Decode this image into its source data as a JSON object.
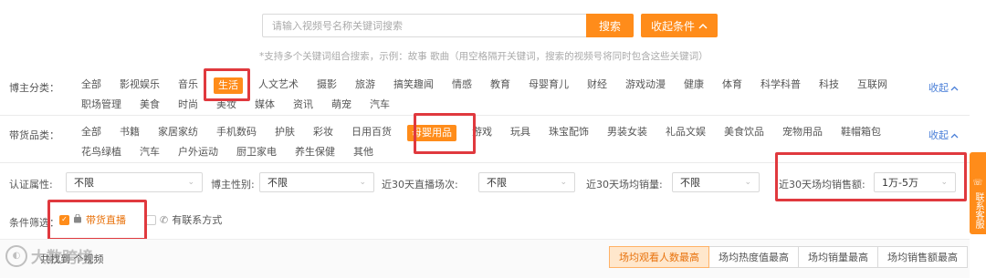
{
  "search": {
    "placeholder": "请输入视频号名称关键词搜索",
    "button_label": "搜索",
    "collapse_label": "收起条件",
    "hint": "*支持多个关键词组合搜索，示例：故事 歌曲（用空格隔开关键词，搜索的视频号将同时包含这些关键词）"
  },
  "blogger_category": {
    "label": "博主分类：",
    "items": [
      "全部",
      "影视娱乐",
      "音乐",
      "生活",
      "人文艺术",
      "摄影",
      "旅游",
      "搞笑趣闻",
      "情感",
      "教育",
      "母婴育儿",
      "财经",
      "游戏动漫",
      "健康",
      "体育",
      "科学科普",
      "科技",
      "互联网",
      "职场管理",
      "美食",
      "时尚",
      "美妆",
      "媒体",
      "资讯",
      "萌宠",
      "汽车"
    ],
    "active": "生活",
    "collapse": "收起"
  },
  "goods_category": {
    "label": "带货品类：",
    "items": [
      "全部",
      "书籍",
      "家居家纺",
      "手机数码",
      "护肤",
      "彩妆",
      "日用百货",
      "母婴用品",
      "游戏",
      "玩具",
      "珠宝配饰",
      "男装女装",
      "礼品文娱",
      "美食饮品",
      "宠物用品",
      "鞋帽箱包",
      "花鸟绿植",
      "汽车",
      "户外运动",
      "厨卫家电",
      "养生保健",
      "其他"
    ],
    "active": "母婴用品",
    "collapse": "收起"
  },
  "selects": [
    {
      "label": "认证属性:",
      "value": "不限"
    },
    {
      "label": "博主性别:",
      "value": "不限"
    },
    {
      "label": "近30天直播场次:",
      "value": "不限"
    },
    {
      "label": "近30天场均销量:",
      "value": "不限"
    },
    {
      "label": "近30天场均销售额:",
      "value": "1万-5万"
    }
  ],
  "conditions": {
    "label": "条件筛选：",
    "live_label": "带货直播",
    "live_checked": true,
    "contact_label": "有联系方式",
    "contact_checked": false
  },
  "results": {
    "text": "共找到 个视频"
  },
  "sort": {
    "options": [
      "场均观看人数最高",
      "场均热度值最高",
      "场均销量最高",
      "场均销售额最高"
    ],
    "active_index": 0
  },
  "side_tab": {
    "label": "联系客服"
  },
  "watermark": {
    "text": "大数跨境"
  },
  "colors": {
    "accent": "#ff8c1a",
    "highlight_box": "#e0393e",
    "link": "#4a7fd8"
  }
}
